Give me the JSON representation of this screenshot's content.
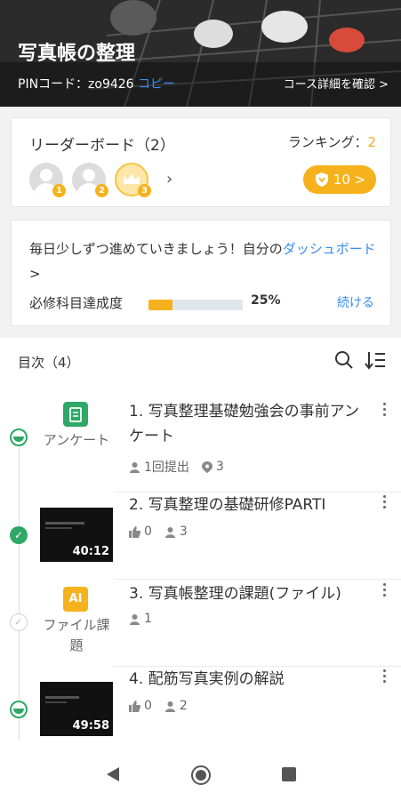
{
  "header": {
    "title": "写真帳の整理",
    "pin_label": "PINコード：zo9426",
    "copy_label": "コピー",
    "detail_link": "コース詳細を確認 >"
  },
  "leaderboard": {
    "title": "リーダーボード（2）",
    "ranking_label": "ランキング：",
    "ranking_value": "2",
    "avatars": [
      {
        "badge": "1"
      },
      {
        "badge": "2"
      },
      {
        "badge": "3"
      }
    ],
    "points_button": "10 >",
    "accent_color": "#f5b21d"
  },
  "progress": {
    "message": "毎日少しずつ進めていきましょう！自分の",
    "dashboard_link": "ダッシュボード",
    "chevron": " >",
    "label": "必修科目達成度",
    "percent": 25,
    "percent_text": "25%",
    "continue_link": "続ける"
  },
  "contents": {
    "header": "目次（4）",
    "items": [
      {
        "title": "1. 写真整理基礎勉強会の事前アンケート",
        "type_label": "アンケート",
        "meta1": "1回提出",
        "meta2": "3",
        "status": "in-progress"
      },
      {
        "title": "2. 写真整理の基礎研修PARTI",
        "duration": "40:12",
        "meta1": "0",
        "meta2": "3",
        "status": "completed"
      },
      {
        "title": "3. 写真帳整理の課題(ファイル)",
        "type_label": "ファイル課題",
        "type_icon": "AI",
        "meta1": "1",
        "status": "not-started"
      },
      {
        "title": "4. 配筋写真実例の解説",
        "duration": "49:58",
        "meta1": "0",
        "meta2": "2",
        "status": "in-progress"
      }
    ]
  },
  "colors": {
    "link": "#3b8df0",
    "green": "#2ea866",
    "gold": "#f5b21d"
  }
}
